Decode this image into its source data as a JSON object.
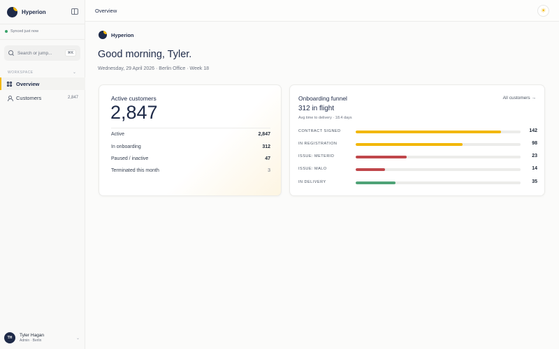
{
  "app": {
    "name": "Hyperion"
  },
  "sidebar": {
    "sync_status": "Synced just now",
    "search": {
      "placeholder": "Search or jump...",
      "shortcut": "⌘K"
    },
    "section_label": "WORKSPACE",
    "items": [
      {
        "label": "Overview",
        "count": "",
        "active": true,
        "icon": "grid-icon"
      },
      {
        "label": "Customers",
        "count": "2,847",
        "active": false,
        "icon": "user-icon"
      }
    ],
    "user": {
      "initials": "TH",
      "name": "Tyler Hagan",
      "role": "Admin · Berlin"
    }
  },
  "topbar": {
    "title": "Overview",
    "theme_icon": "sun-icon"
  },
  "main": {
    "brand": "Hyperion",
    "greeting": "Good morning, Tyler.",
    "subline": "Wednesday, 29 April 2026 · Berlin Office · Week 18",
    "active_card": {
      "title": "Active customers",
      "total": "2,847",
      "rows": [
        {
          "label": "Active",
          "value": "2,847"
        },
        {
          "label": "In onboarding",
          "value": "312"
        },
        {
          "label": "Paused / inactive",
          "value": "47"
        },
        {
          "label": "Terminated this month",
          "value": "3"
        }
      ]
    },
    "funnel_card": {
      "title": "Onboarding funnel",
      "link": "All customers →",
      "in_flight": "312 in flight",
      "avg": "Avg time to delivery · 18.4 days",
      "rows": [
        {
          "label": "CONTRACT SIGNED",
          "count": "142",
          "fill": 0.88,
          "color": "#f2b705"
        },
        {
          "label": "IN REGISTRATION",
          "count": "98",
          "fill": 0.65,
          "color": "#f2b705"
        },
        {
          "label": "ISSUE: METERID",
          "count": "23",
          "fill": 0.31,
          "color": "#c0474b"
        },
        {
          "label": "ISSUE: MALO",
          "count": "14",
          "fill": 0.18,
          "color": "#c0474b"
        },
        {
          "label": "IN DELIVERY",
          "count": "35",
          "fill": 0.24,
          "color": "#4fa377"
        }
      ]
    }
  }
}
